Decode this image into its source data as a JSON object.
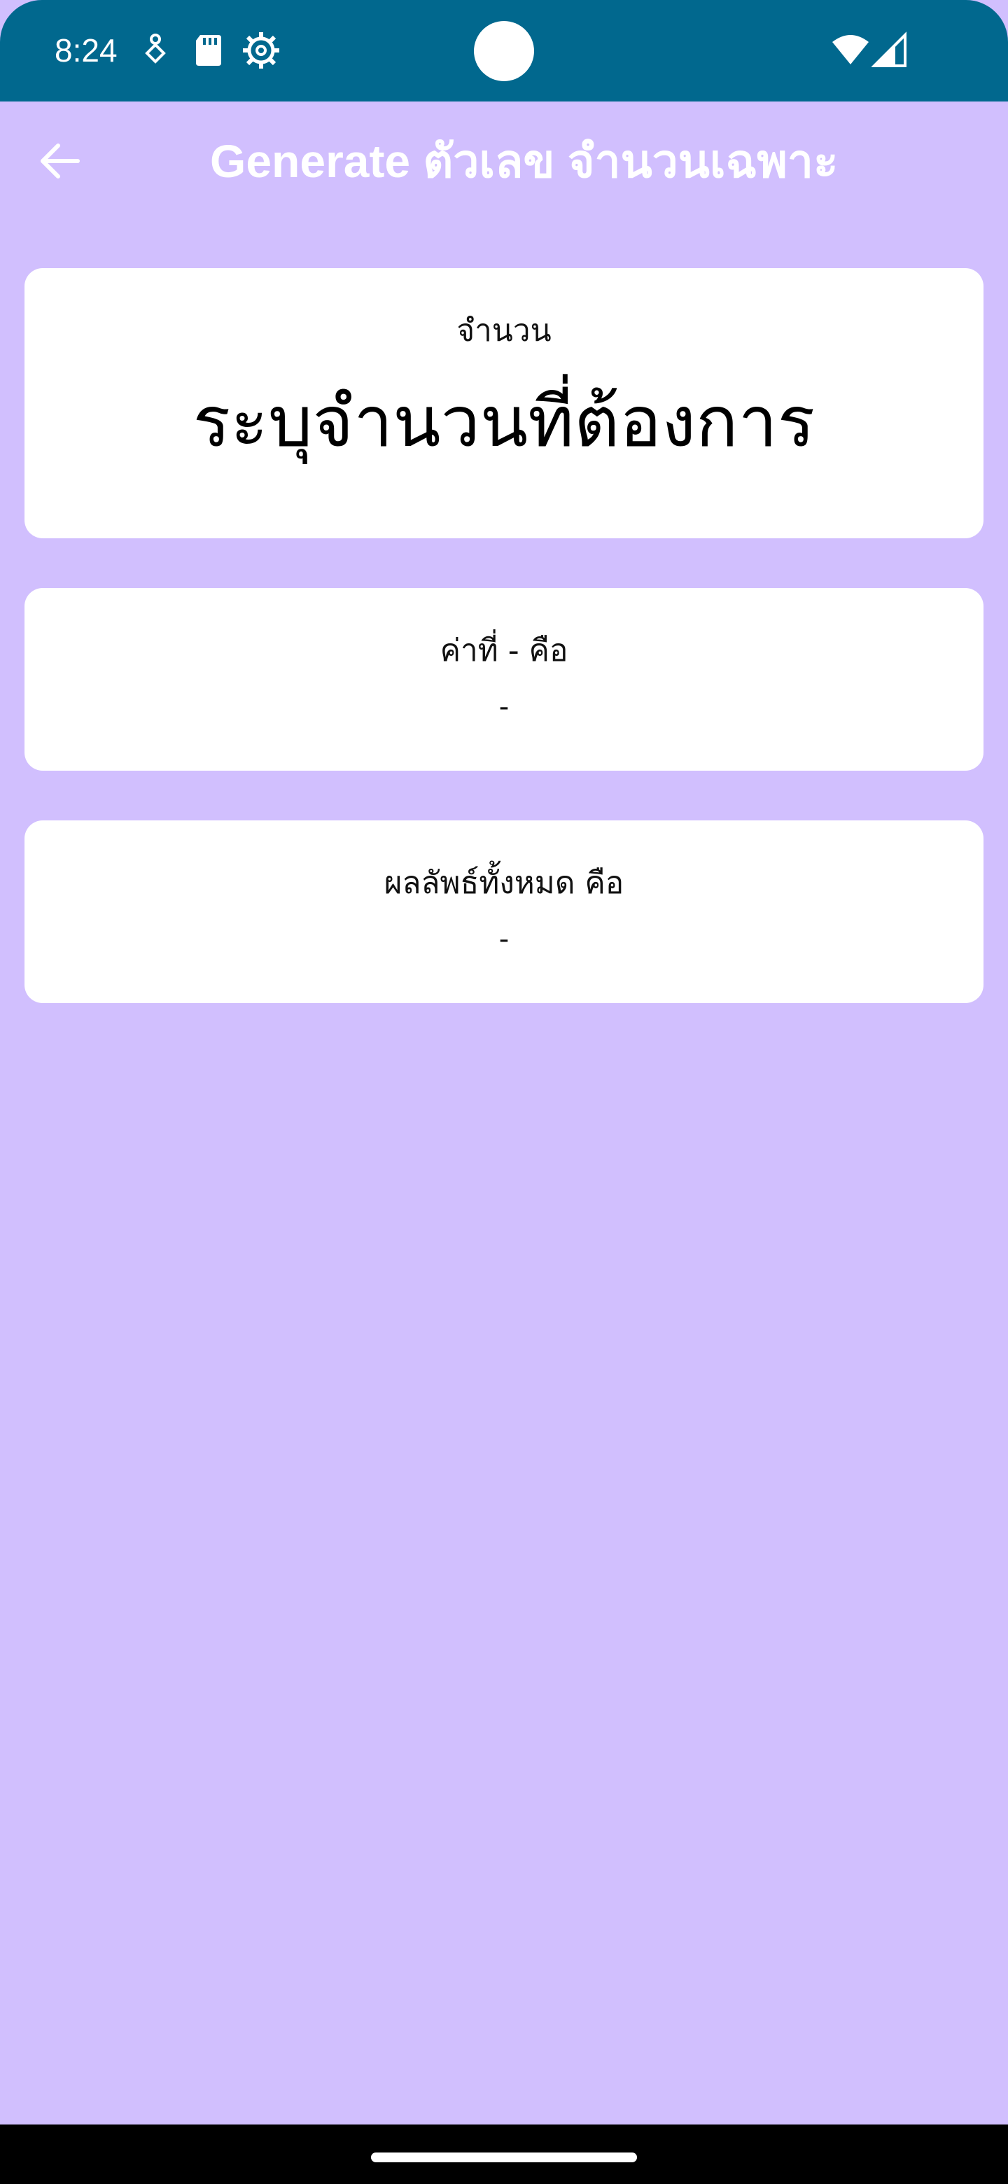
{
  "status_bar": {
    "time": "8:24",
    "icons": [
      "accessibility-icon",
      "sd-card-icon",
      "settings-gear-icon",
      "wifi-icon",
      "cellular-signal-icon"
    ],
    "background_color": "#01688e"
  },
  "app_bar": {
    "title": "Generate ตัวเลข จำนวนเฉพาะ",
    "back_icon": "arrow-back-icon"
  },
  "cards": {
    "count_card": {
      "label": "จำนวน",
      "input_placeholder": "ระบุจำนวนที่ต้องการ"
    },
    "nth_value_card": {
      "label": "ค่าที่ - คือ",
      "value": "-"
    },
    "all_results_card": {
      "label": "ผลลัพธ์ทั้งหมด คือ",
      "value": "-"
    }
  },
  "colors": {
    "page_background": "#d1bffe",
    "card_background": "#ffffff",
    "text": "#111111"
  }
}
